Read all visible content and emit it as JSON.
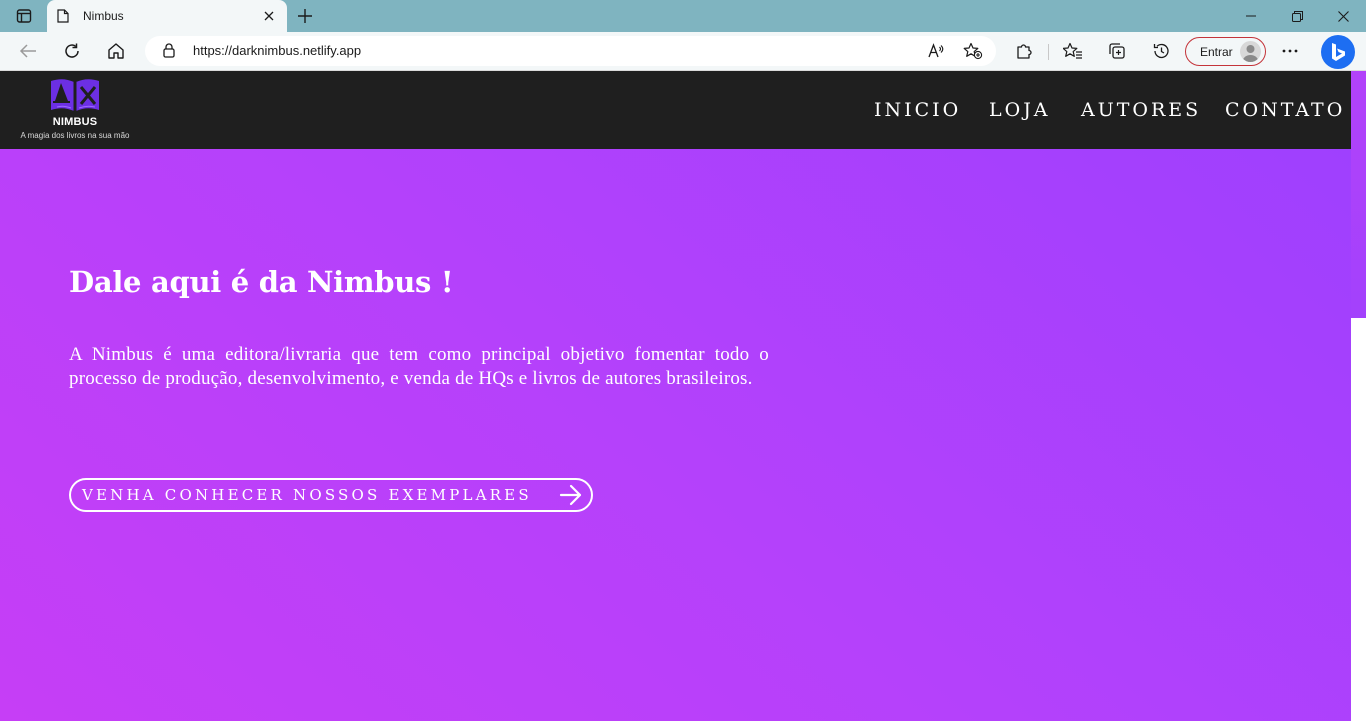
{
  "browser": {
    "tab_title": "Nimbus",
    "url": "https://darknimbus.netlify.app",
    "profile_label": "Entrar"
  },
  "site": {
    "brand": "NIMBUS",
    "tagline": "A magia dos livros na sua mão",
    "nav": [
      "INICIO",
      "LOJA",
      "AUTORES",
      "CONTATO"
    ],
    "colors": {
      "navbar": "#1f1f1f",
      "hero_gradient_start": "#c63ef6",
      "hero_gradient_end": "#9d40fe",
      "logo_purple": "#6c2fe4"
    }
  },
  "hero": {
    "headline": "Dale aqui é da Nimbus !",
    "description": "A Nimbus é uma editora/livraria que tem como principal objetivo fomentar todo o processo de produção, desenvolvimento, e venda de HQs e livros de autores brasileiros.",
    "cta_label": "VENHA CONHECER NOSSOS EXEMPLARES",
    "cta_icon": "arrow-right-icon"
  }
}
